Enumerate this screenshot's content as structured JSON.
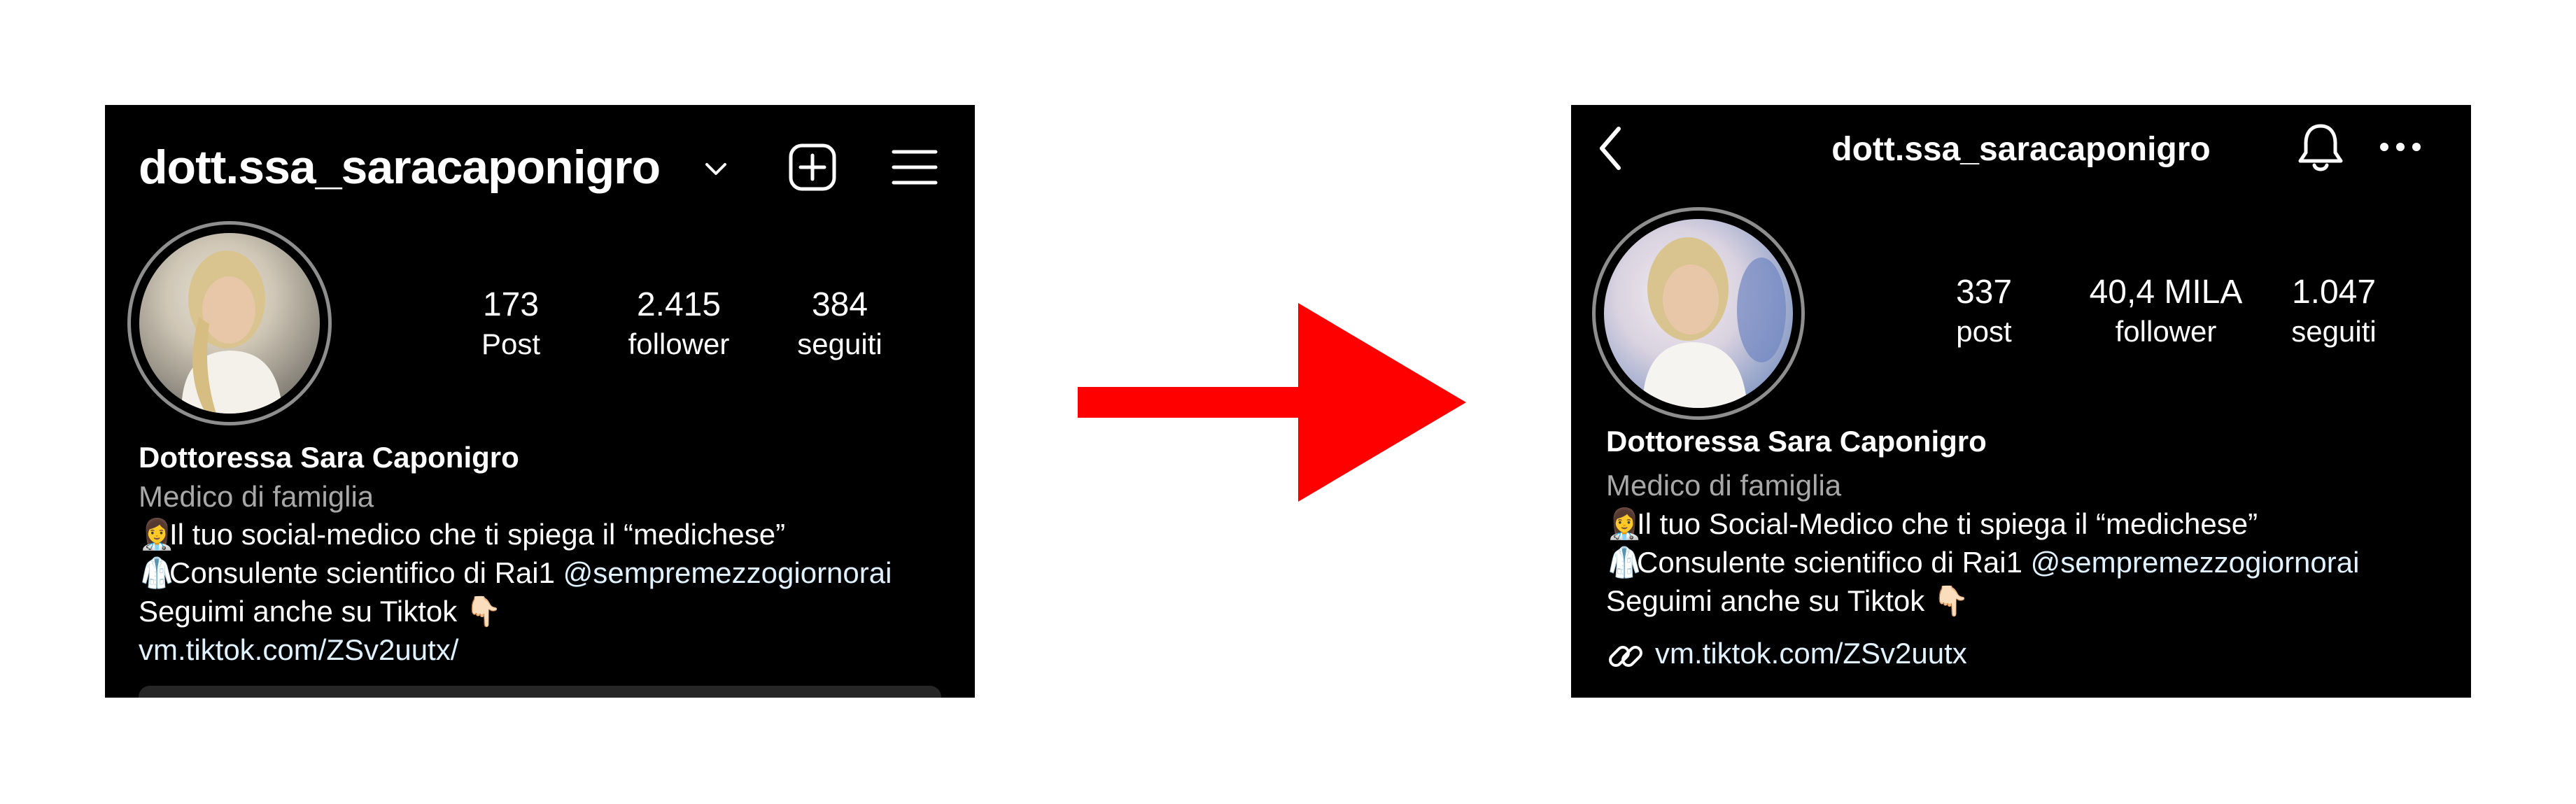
{
  "before": {
    "username": "dott.ssa_saracaponigro",
    "stats": [
      {
        "number": "173",
        "label": "Post"
      },
      {
        "number": "2.415",
        "label": "follower"
      },
      {
        "number": "384",
        "label": "seguiti"
      }
    ],
    "bio": {
      "name": "Dottoressa Sara Caponigro",
      "category": "Medico di famiglia",
      "line1_emoji": "👩‍⚕️",
      "line1_text": "Il tuo social-medico che ti spiega il “medichese”",
      "line2_emoji": "🥼",
      "line2_text": "Consulente scientifico di Rai1 ",
      "line2_mention": "@sempremezzogiornorai",
      "line3_text": "Seguimi anche su Tiktok ",
      "line3_emoji": "👇🏻",
      "link": "vm.tiktok.com/ZSv2uutx/"
    },
    "icons": [
      "chevron-down-icon",
      "add-post-icon",
      "menu-icon"
    ]
  },
  "after": {
    "username": "dott.ssa_saracaponigro",
    "stats": [
      {
        "number": "337",
        "label": "post"
      },
      {
        "number": "40,4 MILA",
        "label": "follower"
      },
      {
        "number": "1.047",
        "label": "seguiti"
      }
    ],
    "bio": {
      "name": "Dottoressa Sara Caponigro",
      "category": "Medico di famiglia",
      "line1_emoji": "👩‍⚕️",
      "line1_text": "Il tuo Social-Medico che ti spiega il “medichese”",
      "line2_emoji": "🥼",
      "line2_text": "Consulente scientifico di Rai1 ",
      "line2_mention": "@sempremezzogiornorai",
      "line3_text": "Seguimi anche su Tiktok ",
      "line3_emoji": "👇🏻",
      "link": "vm.tiktok.com/ZSv2uutx"
    },
    "icons": [
      "back-arrow-icon",
      "bell-icon",
      "more-options-icon",
      "link-icon"
    ]
  },
  "colors": {
    "arrow": "#ff0000",
    "panel_bg": "#000000",
    "secondary_text": "#a8a8a8",
    "link_text": "#e0f1ff"
  }
}
